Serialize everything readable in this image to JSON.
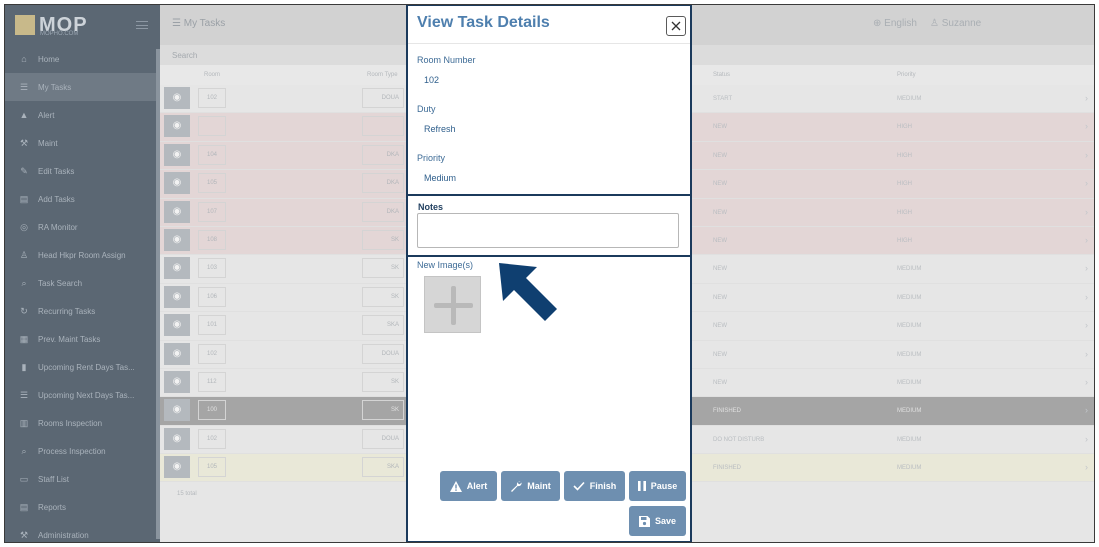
{
  "app": {
    "logo_text": "MOP",
    "logo_sub": "MOPHO.COM",
    "page_title": "My Tasks",
    "language": "English",
    "user": "Suzanne",
    "search_placeholder": "Search",
    "row_count_text": "15 total"
  },
  "sidebar": {
    "items": [
      {
        "label": "Home",
        "icon": "home-icon",
        "glyph": "⌂"
      },
      {
        "label": "My Tasks",
        "icon": "list-icon",
        "glyph": "☰",
        "active": true
      },
      {
        "label": "Alert",
        "icon": "warning-icon",
        "glyph": "▲"
      },
      {
        "label": "Maint",
        "icon": "wrench-icon",
        "glyph": "⚒"
      },
      {
        "label": "Edit Tasks",
        "icon": "edit-icon",
        "glyph": "✎"
      },
      {
        "label": "Add Tasks",
        "icon": "add-tasks-icon",
        "glyph": "▤"
      },
      {
        "label": "RA Monitor",
        "icon": "binoculars-icon",
        "glyph": "◎"
      },
      {
        "label": "Head Hkpr Room Assign",
        "icon": "person-icon",
        "glyph": "♙"
      },
      {
        "label": "Task Search",
        "icon": "search-icon",
        "glyph": "⌕"
      },
      {
        "label": "Recurring Tasks",
        "icon": "recurring-icon",
        "glyph": "↻"
      },
      {
        "label": "Prev. Maint Tasks",
        "icon": "calendar-icon",
        "glyph": "▦"
      },
      {
        "label": "Upcoming Rent Days Tas...",
        "icon": "trash-icon",
        "glyph": "▮"
      },
      {
        "label": "Upcoming Next Days Tas...",
        "icon": "list-icon",
        "glyph": "☰"
      },
      {
        "label": "Rooms Inspection",
        "icon": "building-icon",
        "glyph": "▥"
      },
      {
        "label": "Process Inspection",
        "icon": "search-icon",
        "glyph": "⌕"
      },
      {
        "label": "Staff List",
        "icon": "id-card-icon",
        "glyph": "▭"
      },
      {
        "label": "Reports",
        "icon": "report-icon",
        "glyph": "▤"
      },
      {
        "label": "Administration",
        "icon": "wrench-icon",
        "glyph": "⚒"
      }
    ]
  },
  "table": {
    "columns": [
      "Room",
      "Room Type",
      "Status",
      "Priority"
    ],
    "rows": [
      {
        "room": "102",
        "type": "DOUA",
        "status": "START",
        "priority": "MEDIUM",
        "tone": "normal"
      },
      {
        "room": "",
        "type": "",
        "status": "NEW",
        "priority": "HIGH",
        "tone": "red"
      },
      {
        "room": "104",
        "type": "DKA",
        "status": "NEW",
        "priority": "HIGH",
        "tone": "red"
      },
      {
        "room": "105",
        "type": "DKA",
        "status": "NEW",
        "priority": "HIGH",
        "tone": "red"
      },
      {
        "room": "107",
        "type": "DKA",
        "status": "NEW",
        "priority": "HIGH",
        "tone": "red"
      },
      {
        "room": "108",
        "type": "SK",
        "status": "NEW",
        "priority": "HIGH",
        "tone": "red"
      },
      {
        "room": "103",
        "type": "SK",
        "status": "NEW",
        "priority": "MEDIUM",
        "tone": "normal"
      },
      {
        "room": "106",
        "type": "SK",
        "status": "NEW",
        "priority": "MEDIUM",
        "tone": "normal"
      },
      {
        "room": "101",
        "type": "SKA",
        "status": "NEW",
        "priority": "MEDIUM",
        "tone": "normal"
      },
      {
        "room": "102",
        "type": "DOUA",
        "status": "NEW",
        "priority": "MEDIUM",
        "tone": "normal"
      },
      {
        "room": "112",
        "type": "SK",
        "status": "NEW",
        "priority": "MEDIUM",
        "tone": "normal"
      },
      {
        "room": "100",
        "type": "SK",
        "status": "FINISHED",
        "priority": "MEDIUM",
        "tone": "dark"
      },
      {
        "room": "102",
        "type": "DOUA",
        "status": "DO NOT DISTURB",
        "priority": "MEDIUM",
        "tone": "normal"
      },
      {
        "room": "105",
        "type": "SKA",
        "status": "FINISHED",
        "priority": "MEDIUM",
        "tone": "yellow"
      }
    ]
  },
  "modal": {
    "title": "View Task Details",
    "close_icon": "close-icon",
    "fields": {
      "room_label": "Room Number",
      "room_value": "102",
      "duty_label": "Duty",
      "duty_value": "Refresh",
      "priority_label": "Priority",
      "priority_value": "Medium"
    },
    "notes_label": "Notes",
    "notes_value": "",
    "images_label": "New Image(s)",
    "buttons": {
      "alert": "Alert",
      "maint": "Maint",
      "finish": "Finish",
      "pause": "Pause",
      "save": "Save"
    }
  },
  "colors": {
    "button": "#6e8fb0",
    "title": "#4e7fae",
    "highlight_border": "#1b3a5c",
    "arrow": "#0f3f70"
  }
}
